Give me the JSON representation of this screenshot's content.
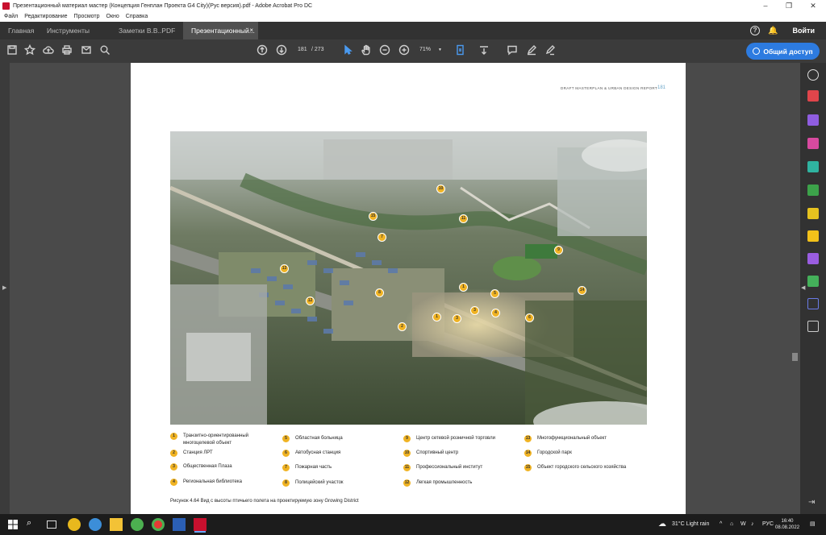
{
  "window": {
    "title": "Презентационный материал мастер (Концепция Генплан Проекта G4 City)(Рус версия).pdf - Adobe Acrobat Pro DC",
    "controls": {
      "minimize": "–",
      "restore": "❐",
      "close": "✕"
    }
  },
  "menu": [
    "Файл",
    "Редактирование",
    "Просмотр",
    "Окно",
    "Справка"
  ],
  "tabs": {
    "home": "Главная",
    "tools": "Инструменты",
    "doc1": "Заметки В.В..PDF",
    "doc2": "Презентационный...",
    "doc2_close": "×",
    "login": "Войти",
    "help": "?"
  },
  "toolbar": {
    "page_current": "181",
    "page_total": "/ 273",
    "zoom": "71%",
    "share_label": "Общий доступ"
  },
  "document": {
    "header_text": "DRAFT MASTERPLAN & URBAN DESIGN REPORT",
    "page_number": "181",
    "caption": "Рисунок 4.64 Вид с высоты птичьего полета на проектируемую зону Growing District",
    "legend": [
      {
        "num": "1",
        "text": "Транзитно-ориентированный многоцелевой объект"
      },
      {
        "num": "2",
        "text": "Станция ЛРТ"
      },
      {
        "num": "3",
        "text": "Общественная Плаза"
      },
      {
        "num": "4",
        "text": "Региональная библиотека"
      },
      {
        "num": "5",
        "text": "Областная больница"
      },
      {
        "num": "6",
        "text": "Автобусная станция"
      },
      {
        "num": "7",
        "text": "Пожарная часть"
      },
      {
        "num": "8",
        "text": "Полицейский участок"
      },
      {
        "num": "9",
        "text": "Центр сетевой розничной торговли"
      },
      {
        "num": "10",
        "text": "Спортивный центр"
      },
      {
        "num": "11",
        "text": "Профессиональный институт"
      },
      {
        "num": "12",
        "text": "Легкая промышленность"
      },
      {
        "num": "13",
        "text": "Многофункциональный объект"
      },
      {
        "num": "14",
        "text": "Городской парк"
      },
      {
        "num": "15",
        "text": "Объект городского сельского хозяйства"
      }
    ],
    "map_pins": [
      "1",
      "1",
      "2",
      "3",
      "3",
      "4",
      "5",
      "6",
      "7",
      "8",
      "9",
      "10",
      "11",
      "12",
      "13",
      "14",
      "15"
    ]
  },
  "taskbar": {
    "weather": "31°C  Light rain",
    "lang": "РУС",
    "time": "16:40",
    "date": "08.08.2022"
  }
}
